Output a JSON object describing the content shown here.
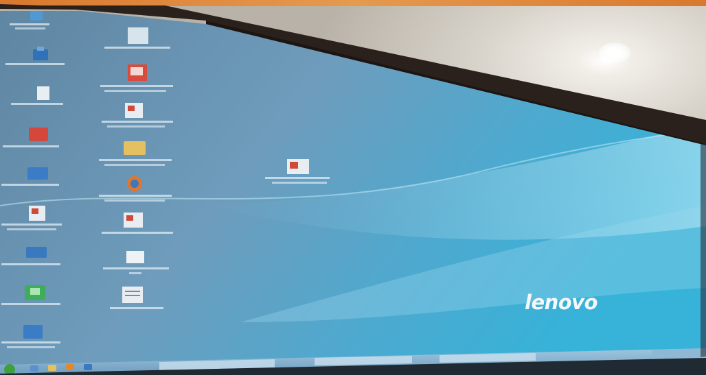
{
  "wallpaper": {
    "brand_logo": "lenovo"
  },
  "desktop_icons": [
    {
      "icon": "shortcut-icon",
      "color": "#4f9ad4",
      "label": ""
    },
    {
      "icon": "document-icon",
      "color": "#d8e4ec",
      "label": ""
    },
    {
      "icon": "network-icon",
      "color": "#2f72b8",
      "label": ""
    },
    {
      "icon": "pdf-icon",
      "color": "#d94b3c",
      "label": ""
    },
    {
      "icon": "file-icon",
      "color": "#e9eef2",
      "label": ""
    },
    {
      "icon": "word-document-icon",
      "color": "#e8edf2",
      "label": ""
    },
    {
      "icon": "flash-installer-icon",
      "color": "#d4473a",
      "label": ""
    },
    {
      "icon": "folder-icon",
      "color": "#e4c060",
      "label": ""
    },
    {
      "icon": "flash-installer-icon",
      "color": "#3c7cc6",
      "label": ""
    },
    {
      "icon": "firefox-icon",
      "color": "#e2762c",
      "label": ""
    },
    {
      "icon": "word-document-icon",
      "color": "#e8edf2",
      "label": ""
    },
    {
      "icon": "text-document-icon",
      "color": "#e8edf2",
      "label": ""
    },
    {
      "icon": "app-icon",
      "color": "#3a78c0",
      "label": ""
    },
    {
      "icon": "blank-file-icon",
      "color": "#eef2f5",
      "label": ""
    },
    {
      "icon": "green-app-icon",
      "color": "#3fae5a",
      "label": ""
    },
    {
      "icon": "notepad-icon",
      "color": "#e8edf2",
      "label": ""
    },
    {
      "icon": "window-app-icon",
      "color": "#3a7cc6",
      "label": ""
    },
    {
      "icon": "word-document-icon",
      "color": "#e8edf2",
      "label": ""
    }
  ],
  "taskbar": {
    "start_orb_color": "#3fa040",
    "pinned": [
      "ie-icon",
      "folder-icon",
      "media-icon",
      "app-icon"
    ],
    "windows": [
      {
        "icon": "ie-icon",
        "label": ""
      },
      {
        "icon": "folder-icon",
        "label": ""
      },
      {
        "icon": "app-icon",
        "label": ""
      }
    ]
  }
}
